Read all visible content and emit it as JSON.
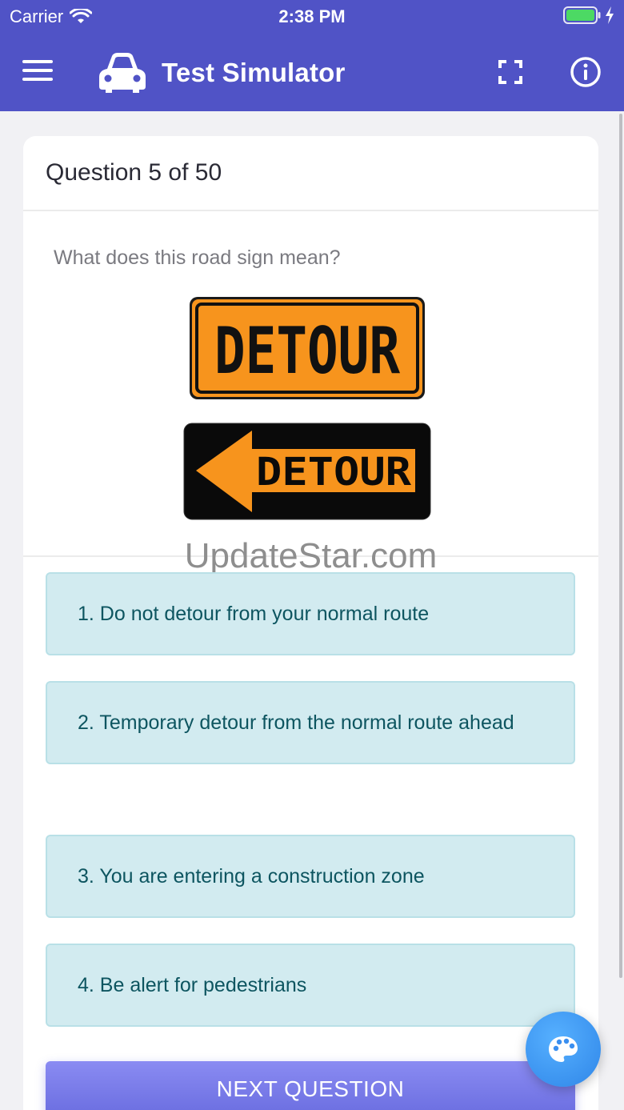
{
  "status_bar": {
    "carrier": "Carrier",
    "time": "2:38 PM"
  },
  "app_bar": {
    "title": "Test Simulator",
    "menu_icon": "hamburger-menu-icon",
    "logo_icon": "car-icon",
    "fullscreen_icon": "fullscreen-icon",
    "info_icon": "info-icon"
  },
  "question": {
    "title": "Question 5 of 50",
    "text": "What does this road sign mean?",
    "sign_1_text": "DETOUR",
    "sign_2_text": "DETOUR"
  },
  "watermark": "UpdateStar.com",
  "answers": [
    {
      "label": "1. Do not detour from your normal route"
    },
    {
      "label": "2. Temporary detour from the normal route ahead"
    },
    {
      "label": "3. You are entering a construction zone"
    },
    {
      "label": "4. Be alert for pedestrians"
    }
  ],
  "next_button": {
    "label": "NEXT QUESTION"
  },
  "fab": {
    "icon": "palette-icon"
  },
  "colors": {
    "primary": "#5053c6",
    "answer_bg": "#d2ebf0",
    "answer_text": "#0d5560",
    "sign_orange": "#f7941d",
    "fab": "#2f86e8"
  }
}
